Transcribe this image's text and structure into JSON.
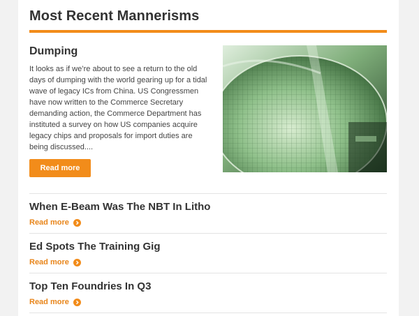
{
  "section": {
    "title": "Most Recent Mannerisms"
  },
  "featured": {
    "title": "Dumping",
    "excerpt": "It looks as if we’re about to see a return to the old days of dumping with the world gearing up for a tidal wave of legacy ICs from China. US Congressmen have now written to the Commerce Secretary demanding action, the Commerce Department has instituted a survey on how US companies acquire legacy chips and proposals for import duties are being discussed....",
    "button_label": "Read more",
    "image_icon": "silicon-wafer-photo"
  },
  "posts": [
    {
      "title": "When E-Beam Was The NBT In Litho",
      "link_label": "Read more"
    },
    {
      "title": "Ed Spots The Training Gig",
      "link_label": "Read more"
    },
    {
      "title": "Top Ten Foundries In Q3",
      "link_label": "Read more"
    }
  ],
  "colors": {
    "accent": "#f28c1a",
    "link": "#e8851a",
    "text": "#333333",
    "background": "#f2f2f2",
    "card": "#ffffff"
  },
  "icons": {
    "link_arrow": "chevron-right-circle-icon"
  }
}
